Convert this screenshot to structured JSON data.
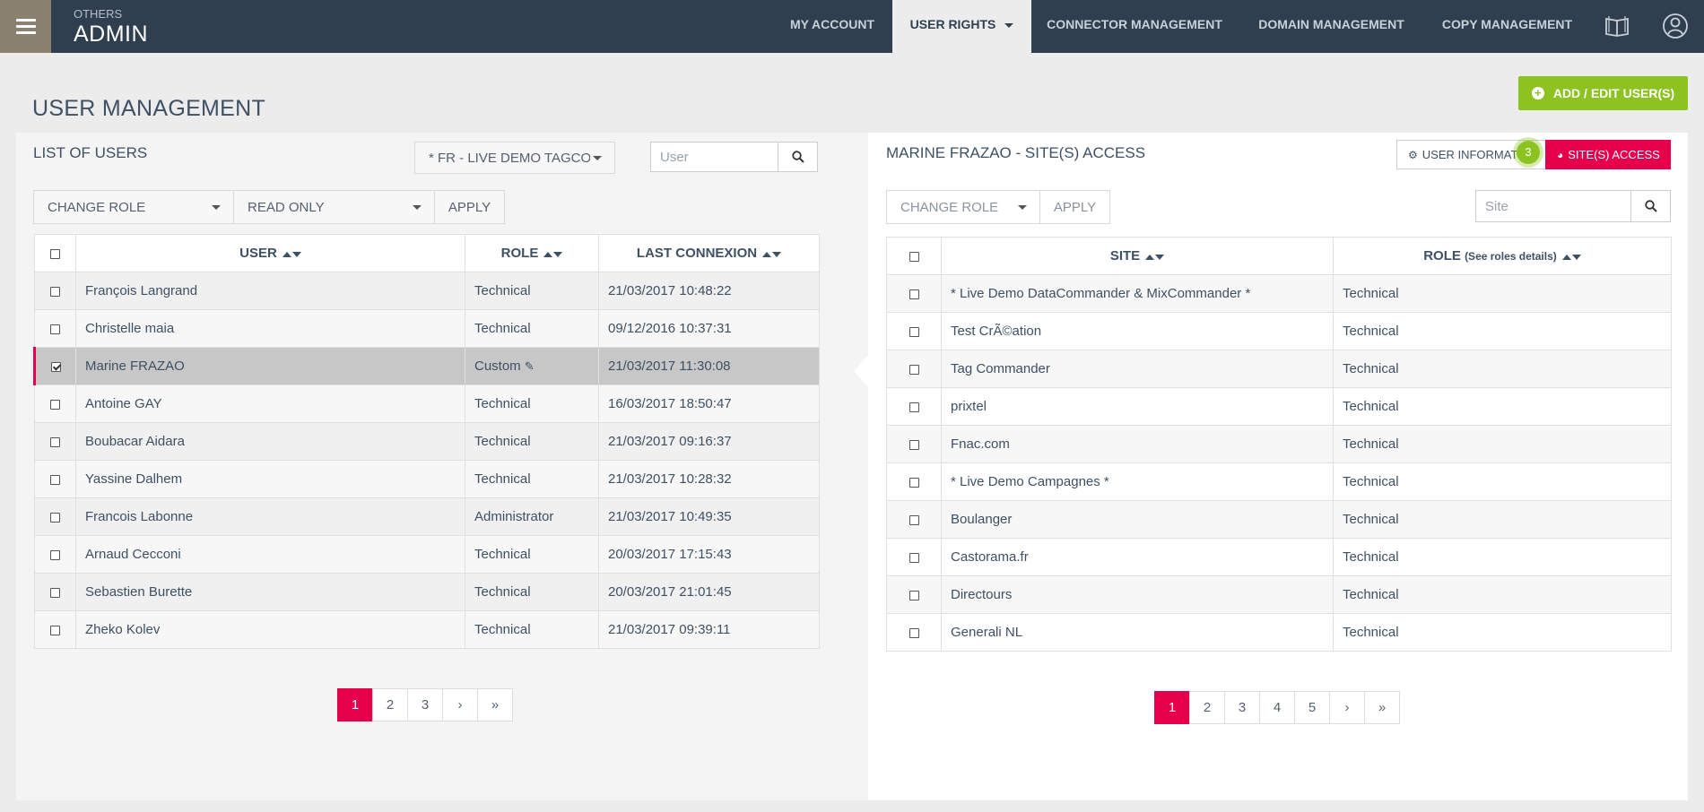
{
  "header": {
    "section": "OTHERS",
    "title": "ADMIN",
    "nav": {
      "my_account": "MY ACCOUNT",
      "user_rights": "USER RIGHTS",
      "connector_management": "CONNECTOR MANAGEMENT",
      "domain_management": "DOMAIN MANAGEMENT",
      "copy_management": "COPY MANAGEMENT"
    },
    "icons": {
      "menu": "hamburger-icon",
      "help": "book-icon",
      "user": "user-icon"
    }
  },
  "page": {
    "title": "USER MANAGEMENT",
    "add_button": "ADD / EDIT USER(S)"
  },
  "left": {
    "title": "LIST OF USERS",
    "site_select": "* FR - LIVE DEMO TAGCOMMANDER",
    "search_placeholder": "User",
    "change_role": "CHANGE ROLE",
    "read_only": "READ ONLY",
    "apply": "APPLY",
    "columns": {
      "user": "USER",
      "role": "ROLE",
      "last": "LAST CONNEXION"
    },
    "rows": [
      {
        "user": "François Langrand",
        "role": "Technical",
        "last": "21/03/2017 10:48:22",
        "checked": false
      },
      {
        "user": "Christelle maia",
        "role": "Technical",
        "last": "09/12/2016 10:37:31",
        "checked": false
      },
      {
        "user": "Marine FRAZAO",
        "role": "Custom",
        "last": "21/03/2017 11:30:08",
        "checked": true
      },
      {
        "user": "Antoine GAY",
        "role": "Technical",
        "last": "16/03/2017 18:50:47",
        "checked": false
      },
      {
        "user": "Boubacar Aidara",
        "role": "Technical",
        "last": "21/03/2017 09:16:37",
        "checked": false
      },
      {
        "user": "Yassine Dalhem",
        "role": "Technical",
        "last": "21/03/2017 10:28:32",
        "checked": false
      },
      {
        "user": "Francois Labonne",
        "role": "Administrator",
        "last": "21/03/2017 10:49:35",
        "checked": false
      },
      {
        "user": "Arnaud Cecconi",
        "role": "Technical",
        "last": "20/03/2017 17:15:43",
        "checked": false
      },
      {
        "user": "Sebastien Burette",
        "role": "Technical",
        "last": "20/03/2017 21:01:45",
        "checked": false
      },
      {
        "user": "Zheko Kolev",
        "role": "Technical",
        "last": "21/03/2017 09:39:11",
        "checked": false
      }
    ],
    "pages": [
      "1",
      "2",
      "3",
      "›",
      "»"
    ],
    "active_page": "1"
  },
  "right": {
    "title": "MARINE FRAZAO - SITE(S) ACCESS",
    "tab_info": "USER INFORMATION",
    "tab_sites": "SITE(S) ACCESS",
    "badge": "3",
    "change_role": "CHANGE ROLE",
    "apply": "APPLY",
    "search_placeholder": "Site",
    "columns": {
      "site": "SITE",
      "role": "ROLE",
      "role_note": "(See roles details)"
    },
    "rows": [
      {
        "site": "* Live Demo DataCommander & MixCommander *",
        "role": "Technical"
      },
      {
        "site": "Test CrÃ©ation",
        "role": "Technical"
      },
      {
        "site": "Tag Commander",
        "role": "Technical"
      },
      {
        "site": "prixtel",
        "role": "Technical"
      },
      {
        "site": "Fnac.com",
        "role": "Technical"
      },
      {
        "site": "* Live Demo Campagnes *",
        "role": "Technical"
      },
      {
        "site": "Boulanger",
        "role": "Technical"
      },
      {
        "site": "Castorama.fr",
        "role": "Technical"
      },
      {
        "site": "Directours",
        "role": "Technical"
      },
      {
        "site": "Generali NL",
        "role": "Technical"
      }
    ],
    "pages": [
      "1",
      "2",
      "3",
      "4",
      "5",
      "›",
      "»"
    ],
    "active_page": "1"
  },
  "colors": {
    "accent": "#e6004c",
    "success": "#8cc321",
    "nav_bg": "#2f3f4f"
  }
}
